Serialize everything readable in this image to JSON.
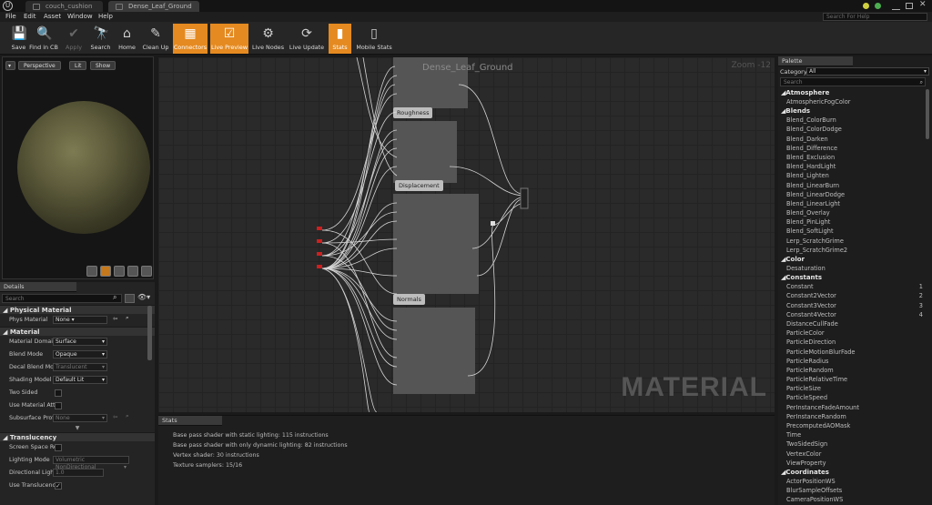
{
  "tabs": [
    {
      "label": "couch_cushion"
    },
    {
      "label": "Dense_Leaf_Ground"
    }
  ],
  "menu": [
    "File",
    "Edit",
    "Asset",
    "Window",
    "Help"
  ],
  "help_search_placeholder": "Search For Help",
  "toolbar": [
    {
      "label": "Save",
      "icon": "save-icon",
      "state": "normal"
    },
    {
      "label": "Find in CB",
      "icon": "find-in-cb-icon",
      "state": "normal"
    },
    {
      "label": "Apply",
      "icon": "apply-icon",
      "state": "disabled"
    },
    {
      "label": "Search",
      "icon": "search-icon",
      "state": "normal"
    },
    {
      "label": "Home",
      "icon": "home-icon",
      "state": "normal"
    },
    {
      "label": "Clean Up",
      "icon": "clean-up-icon",
      "state": "normal"
    },
    {
      "label": "Connectors",
      "icon": "connectors-icon",
      "state": "active"
    },
    {
      "label": "Live Preview",
      "icon": "live-preview-icon",
      "state": "active"
    },
    {
      "label": "Live Nodes",
      "icon": "live-nodes-icon",
      "state": "normal"
    },
    {
      "label": "Live Update",
      "icon": "live-update-icon",
      "state": "normal"
    },
    {
      "label": "Stats",
      "icon": "stats-icon",
      "state": "active"
    },
    {
      "label": "Mobile Stats",
      "icon": "mobile-stats-icon",
      "state": "normal"
    }
  ],
  "viewport": {
    "perspective": "Perspective",
    "lit": "Lit",
    "show": "Show"
  },
  "details": {
    "title": "Details",
    "search_placeholder": "Search",
    "physical_material": {
      "header": "Physical Material",
      "phys_material_label": "Phys Material",
      "phys_material_value": "None"
    },
    "material": {
      "header": "Material",
      "rows": [
        {
          "label": "Material Domain",
          "value": "Surface"
        },
        {
          "label": "Blend Mode",
          "value": "Opaque"
        },
        {
          "label": "Decal Blend Mode",
          "value": "Translucent"
        },
        {
          "label": "Shading Model",
          "value": "Default Lit"
        },
        {
          "label": "Two Sided",
          "value": ""
        },
        {
          "label": "Use Material Attr",
          "value": ""
        },
        {
          "label": "Subsurface Profil",
          "value": "None"
        }
      ]
    },
    "translucency": {
      "header": "Translucency",
      "rows": [
        {
          "label": "Screen Space Re",
          "value": ""
        },
        {
          "label": "Lighting Mode",
          "value": "Volumetric NonDirectional"
        },
        {
          "label": "Directional Lighti",
          "value": "1.0"
        },
        {
          "label": "Use Translucenc",
          "value": ""
        }
      ]
    }
  },
  "graph": {
    "title": "Dense_Leaf_Ground",
    "zoom": "Zoom -12",
    "watermark": "MATERIAL",
    "comments": [
      "Roughness",
      "Displacement",
      "Normals"
    ]
  },
  "stats": {
    "title": "Stats",
    "lines": [
      "Base pass shader with static lighting: 115 instructions",
      "Base pass shader with only dynamic lighting: 82 instructions",
      "Vertex shader: 30 instructions",
      "Texture samplers: 15/16"
    ]
  },
  "palette": {
    "title": "Palette",
    "category_label": "Category",
    "category_value": "All",
    "search_placeholder": "Search",
    "groups": [
      {
        "name": "Atmosphere",
        "items": [
          {
            "label": "AtmosphericFogColor"
          }
        ]
      },
      {
        "name": "Blends",
        "items": [
          {
            "label": "Blend_ColorBurn"
          },
          {
            "label": "Blend_ColorDodge"
          },
          {
            "label": "Blend_Darken"
          },
          {
            "label": "Blend_Difference"
          },
          {
            "label": "Blend_Exclusion"
          },
          {
            "label": "Blend_HardLight"
          },
          {
            "label": "Blend_Lighten"
          },
          {
            "label": "Blend_LinearBurn"
          },
          {
            "label": "Blend_LinearDodge"
          },
          {
            "label": "Blend_LinearLight"
          },
          {
            "label": "Blend_Overlay"
          },
          {
            "label": "Blend_PinLight"
          },
          {
            "label": "Blend_SoftLight"
          },
          {
            "label": "Lerp_ScratchGrime"
          },
          {
            "label": "Lerp_ScratchGrime2"
          }
        ]
      },
      {
        "name": "Color",
        "items": [
          {
            "label": "Desaturation"
          }
        ]
      },
      {
        "name": "Constants",
        "items": [
          {
            "label": "Constant",
            "key": "1"
          },
          {
            "label": "Constant2Vector",
            "key": "2"
          },
          {
            "label": "Constant3Vector",
            "key": "3"
          },
          {
            "label": "Constant4Vector",
            "key": "4"
          },
          {
            "label": "DistanceCullFade"
          },
          {
            "label": "ParticleColor"
          },
          {
            "label": "ParticleDirection"
          },
          {
            "label": "ParticleMotionBlurFade"
          },
          {
            "label": "ParticleRadius"
          },
          {
            "label": "ParticleRandom"
          },
          {
            "label": "ParticleRelativeTime"
          },
          {
            "label": "ParticleSize"
          },
          {
            "label": "ParticleSpeed"
          },
          {
            "label": "PerInstanceFadeAmount"
          },
          {
            "label": "PerInstanceRandom"
          },
          {
            "label": "PrecomputedAOMask"
          },
          {
            "label": "Time"
          },
          {
            "label": "TwoSidedSign"
          },
          {
            "label": "VertexColor"
          },
          {
            "label": "ViewProperty"
          }
        ]
      },
      {
        "name": "Coordinates",
        "items": [
          {
            "label": "ActorPositionWS"
          },
          {
            "label": "BlurSampleOffsets"
          },
          {
            "label": "CameraPositionWS"
          }
        ]
      }
    ]
  }
}
